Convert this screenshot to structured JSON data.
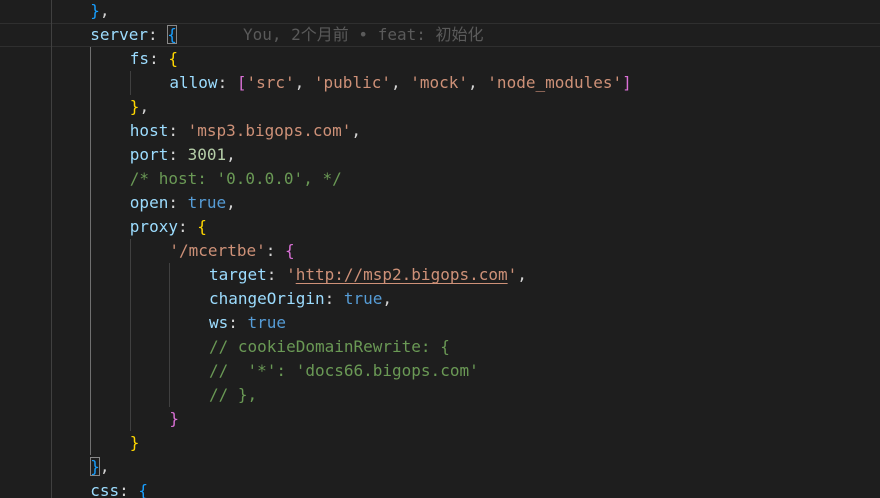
{
  "editor": {
    "blame": "You, 2个月前 • feat: 初始化",
    "lines": [
      {
        "indent": 2,
        "tokens": [
          {
            "t": "}",
            "k": "b3"
          },
          {
            "t": ",",
            "k": "punc"
          }
        ]
      },
      {
        "indent": 2,
        "current": true,
        "tokens": [
          {
            "t": "server",
            "k": "prop"
          },
          {
            "t": ": ",
            "k": "punc"
          },
          {
            "t": "{",
            "k": "b3",
            "match": true
          }
        ]
      },
      {
        "indent": 3,
        "tokens": [
          {
            "t": "fs",
            "k": "prop"
          },
          {
            "t": ": ",
            "k": "punc"
          },
          {
            "t": "{",
            "k": "b1"
          }
        ]
      },
      {
        "indent": 4,
        "tokens": [
          {
            "t": "allow",
            "k": "prop"
          },
          {
            "t": ": ",
            "k": "punc"
          },
          {
            "t": "[",
            "k": "b2"
          },
          {
            "t": "'src'",
            "k": "str"
          },
          {
            "t": ", ",
            "k": "punc"
          },
          {
            "t": "'public'",
            "k": "str"
          },
          {
            "t": ", ",
            "k": "punc"
          },
          {
            "t": "'mock'",
            "k": "str"
          },
          {
            "t": ", ",
            "k": "punc"
          },
          {
            "t": "'node_modules'",
            "k": "str"
          },
          {
            "t": "]",
            "k": "b2"
          }
        ]
      },
      {
        "indent": 3,
        "tokens": [
          {
            "t": "}",
            "k": "b1"
          },
          {
            "t": ",",
            "k": "punc"
          }
        ]
      },
      {
        "indent": 3,
        "tokens": [
          {
            "t": "host",
            "k": "prop"
          },
          {
            "t": ": ",
            "k": "punc"
          },
          {
            "t": "'msp3.bigops.com'",
            "k": "str"
          },
          {
            "t": ",",
            "k": "punc"
          }
        ]
      },
      {
        "indent": 3,
        "tokens": [
          {
            "t": "port",
            "k": "prop"
          },
          {
            "t": ": ",
            "k": "punc"
          },
          {
            "t": "3001",
            "k": "num"
          },
          {
            "t": ",",
            "k": "punc"
          }
        ]
      },
      {
        "indent": 3,
        "tokens": [
          {
            "t": "/* host: '0.0.0.0', */",
            "k": "cmt"
          }
        ]
      },
      {
        "indent": 3,
        "tokens": [
          {
            "t": "open",
            "k": "prop"
          },
          {
            "t": ": ",
            "k": "punc"
          },
          {
            "t": "true",
            "k": "kw"
          },
          {
            "t": ",",
            "k": "punc"
          }
        ]
      },
      {
        "indent": 3,
        "tokens": [
          {
            "t": "proxy",
            "k": "prop"
          },
          {
            "t": ": ",
            "k": "punc"
          },
          {
            "t": "{",
            "k": "b1"
          }
        ]
      },
      {
        "indent": 4,
        "tokens": [
          {
            "t": "'/mcertbe'",
            "k": "str"
          },
          {
            "t": ": ",
            "k": "punc"
          },
          {
            "t": "{",
            "k": "b2"
          }
        ]
      },
      {
        "indent": 5,
        "tokens": [
          {
            "t": "target",
            "k": "prop"
          },
          {
            "t": ": ",
            "k": "punc"
          },
          {
            "t": "'",
            "k": "str"
          },
          {
            "t": "http://msp2.bigops.com",
            "k": "str",
            "link": true
          },
          {
            "t": "'",
            "k": "str"
          },
          {
            "t": ",",
            "k": "punc"
          }
        ]
      },
      {
        "indent": 5,
        "tokens": [
          {
            "t": "changeOrigin",
            "k": "prop"
          },
          {
            "t": ": ",
            "k": "punc"
          },
          {
            "t": "true",
            "k": "kw"
          },
          {
            "t": ",",
            "k": "punc"
          }
        ]
      },
      {
        "indent": 5,
        "tokens": [
          {
            "t": "ws",
            "k": "prop"
          },
          {
            "t": ": ",
            "k": "punc"
          },
          {
            "t": "true",
            "k": "kw"
          }
        ]
      },
      {
        "indent": 5,
        "tokens": [
          {
            "t": "// cookieDomainRewrite: {",
            "k": "cmt"
          }
        ]
      },
      {
        "indent": 5,
        "tokens": [
          {
            "t": "//  '*': 'docs66.bigops.com'",
            "k": "cmt"
          }
        ]
      },
      {
        "indent": 5,
        "tokens": [
          {
            "t": "// },",
            "k": "cmt"
          }
        ]
      },
      {
        "indent": 4,
        "tokens": [
          {
            "t": "}",
            "k": "b2"
          }
        ]
      },
      {
        "indent": 3,
        "tokens": [
          {
            "t": "}",
            "k": "b1"
          }
        ]
      },
      {
        "indent": 2,
        "tokens": [
          {
            "t": "}",
            "k": "b3",
            "match": true
          },
          {
            "t": ",",
            "k": "punc"
          }
        ]
      },
      {
        "indent": 2,
        "tokens": [
          {
            "t": "css",
            "k": "prop"
          },
          {
            "t": ": ",
            "k": "punc"
          },
          {
            "t": "{",
            "k": "b3"
          }
        ]
      }
    ]
  }
}
